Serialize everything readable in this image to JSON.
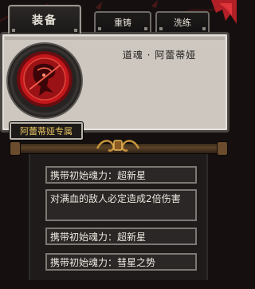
{
  "tabs": [
    {
      "label": "装备",
      "active": true
    },
    {
      "label": "重铸",
      "active": false
    },
    {
      "label": "洗练",
      "active": false
    }
  ],
  "soul": {
    "name": "道魂 · 阿蕾蒂娅",
    "owner_label": "阿蕾蒂娅专属",
    "emblem_icon": "red-soul-emblem-icon"
  },
  "effects": [
    "携带初始魂力：超新星",
    "对满血的敌人必定造成2倍伤害",
    "携带初始魂力：超新星",
    "携带初始魂力：彗星之势"
  ],
  "colors": {
    "panel_bg": "#cdc7c0",
    "badge_text": "#e8c463",
    "emblem_red": "#c3171c",
    "scroll_wood": "#5b4227"
  }
}
